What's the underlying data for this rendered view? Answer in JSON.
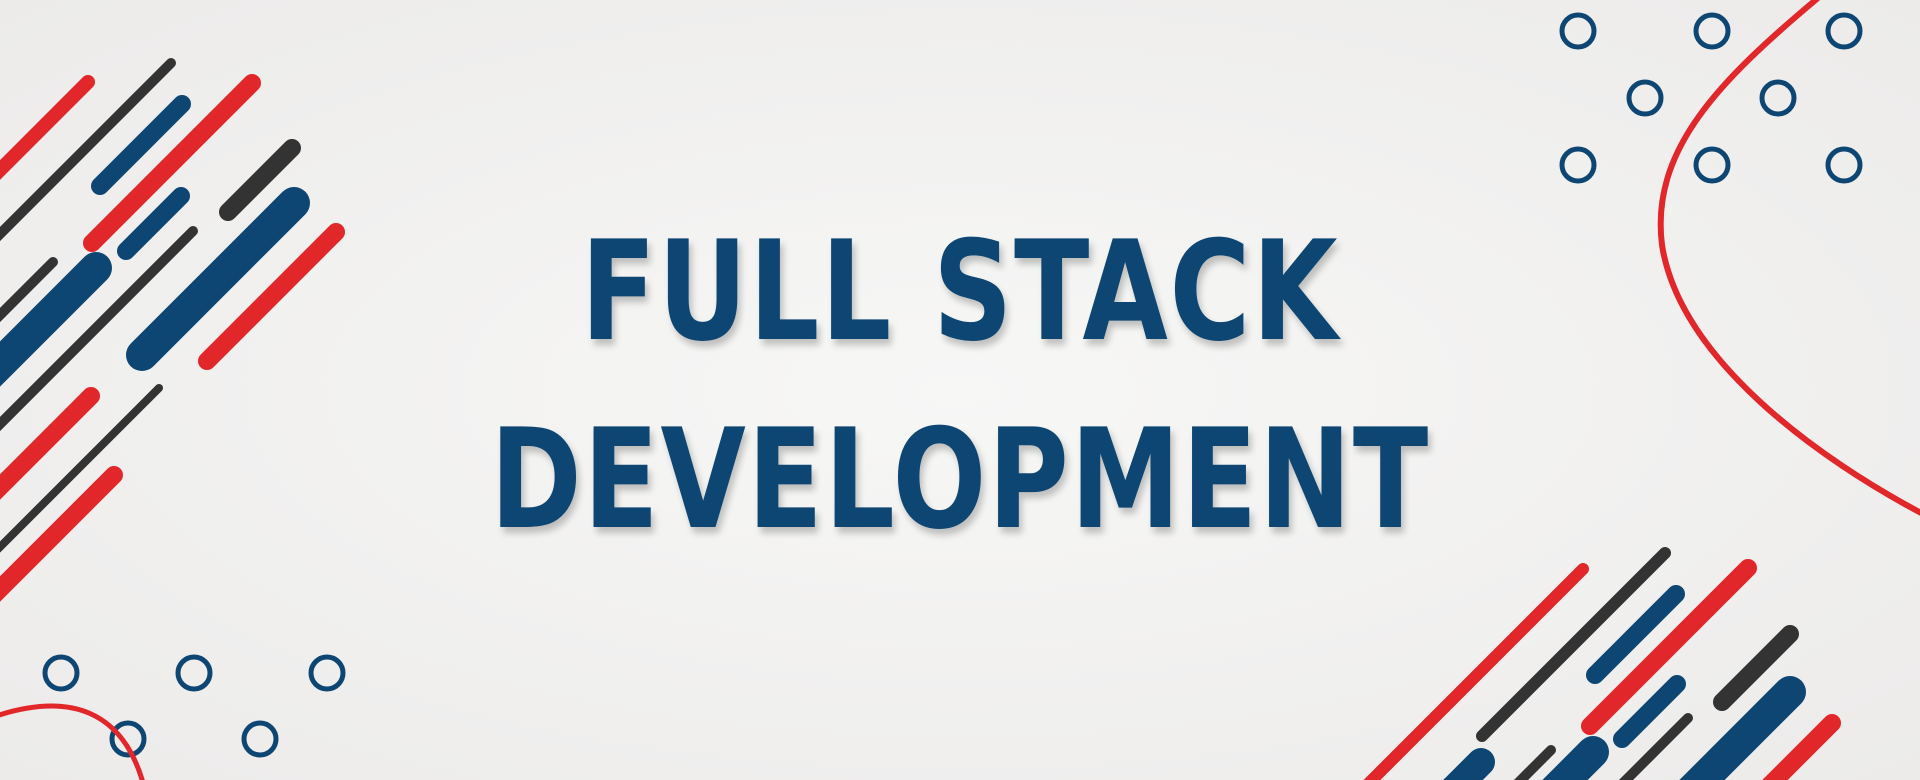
{
  "title": {
    "line1": "FULL STACK",
    "line2": "DEVELOPMENT"
  },
  "colors": {
    "background": "#f4f4f3",
    "navy": "#0e4673",
    "red": "#e2272b",
    "dark": "#333333"
  },
  "decorations": {
    "ring-icon": "circle-outline",
    "stripe-icon": "diagonal-rounded-line",
    "curve-icon": "arc-line"
  }
}
